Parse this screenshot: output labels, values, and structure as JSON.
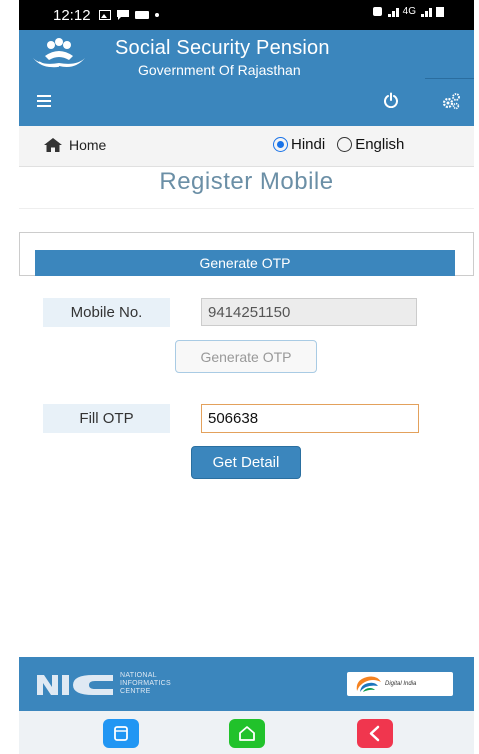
{
  "status_bar": {
    "time": "12:12",
    "network": "4G"
  },
  "header": {
    "title": "Social Security Pension",
    "subtitle": "Government Of Rajasthan"
  },
  "nav": {
    "home_label": "Home",
    "languages": [
      {
        "label": "Hindi",
        "selected": true
      },
      {
        "label": "English",
        "selected": false
      }
    ]
  },
  "page": {
    "title": "Register Mobile",
    "panel_heading": "Generate OTP",
    "mobile_label": "Mobile No.",
    "mobile_value": "9414251150",
    "generate_button": "Generate OTP",
    "otp_label": "Fill OTP",
    "otp_value": "506638",
    "get_detail_button": "Get Detail"
  },
  "footer": {
    "nic_line1": "NATIONAL",
    "nic_line2": "INFORMATICS",
    "nic_line3": "CENTRE",
    "digital_india": "Digital India"
  },
  "colors": {
    "primary": "#3b86bd",
    "panel_label_bg": "#e8f1f8",
    "otp_border": "#e3a15c"
  }
}
